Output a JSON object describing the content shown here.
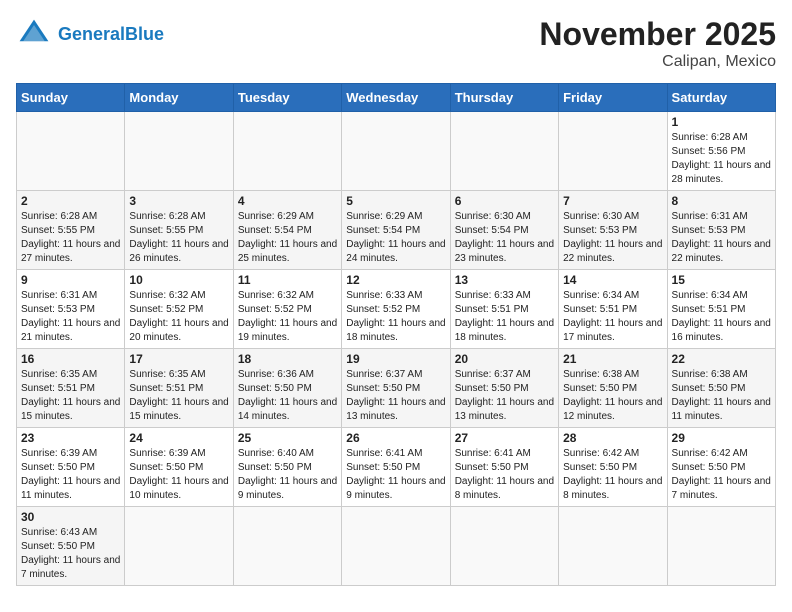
{
  "header": {
    "logo_general": "General",
    "logo_blue": "Blue",
    "title": "November 2025",
    "subtitle": "Calipan, Mexico"
  },
  "weekdays": [
    "Sunday",
    "Monday",
    "Tuesday",
    "Wednesday",
    "Thursday",
    "Friday",
    "Saturday"
  ],
  "weeks": [
    [
      {
        "day": "",
        "info": ""
      },
      {
        "day": "",
        "info": ""
      },
      {
        "day": "",
        "info": ""
      },
      {
        "day": "",
        "info": ""
      },
      {
        "day": "",
        "info": ""
      },
      {
        "day": "",
        "info": ""
      },
      {
        "day": "1",
        "info": "Sunrise: 6:28 AM\nSunset: 5:56 PM\nDaylight: 11 hours and 28 minutes."
      }
    ],
    [
      {
        "day": "2",
        "info": "Sunrise: 6:28 AM\nSunset: 5:55 PM\nDaylight: 11 hours and 27 minutes."
      },
      {
        "day": "3",
        "info": "Sunrise: 6:28 AM\nSunset: 5:55 PM\nDaylight: 11 hours and 26 minutes."
      },
      {
        "day": "4",
        "info": "Sunrise: 6:29 AM\nSunset: 5:54 PM\nDaylight: 11 hours and 25 minutes."
      },
      {
        "day": "5",
        "info": "Sunrise: 6:29 AM\nSunset: 5:54 PM\nDaylight: 11 hours and 24 minutes."
      },
      {
        "day": "6",
        "info": "Sunrise: 6:30 AM\nSunset: 5:54 PM\nDaylight: 11 hours and 23 minutes."
      },
      {
        "day": "7",
        "info": "Sunrise: 6:30 AM\nSunset: 5:53 PM\nDaylight: 11 hours and 22 minutes."
      },
      {
        "day": "8",
        "info": "Sunrise: 6:31 AM\nSunset: 5:53 PM\nDaylight: 11 hours and 22 minutes."
      }
    ],
    [
      {
        "day": "9",
        "info": "Sunrise: 6:31 AM\nSunset: 5:53 PM\nDaylight: 11 hours and 21 minutes."
      },
      {
        "day": "10",
        "info": "Sunrise: 6:32 AM\nSunset: 5:52 PM\nDaylight: 11 hours and 20 minutes."
      },
      {
        "day": "11",
        "info": "Sunrise: 6:32 AM\nSunset: 5:52 PM\nDaylight: 11 hours and 19 minutes."
      },
      {
        "day": "12",
        "info": "Sunrise: 6:33 AM\nSunset: 5:52 PM\nDaylight: 11 hours and 18 minutes."
      },
      {
        "day": "13",
        "info": "Sunrise: 6:33 AM\nSunset: 5:51 PM\nDaylight: 11 hours and 18 minutes."
      },
      {
        "day": "14",
        "info": "Sunrise: 6:34 AM\nSunset: 5:51 PM\nDaylight: 11 hours and 17 minutes."
      },
      {
        "day": "15",
        "info": "Sunrise: 6:34 AM\nSunset: 5:51 PM\nDaylight: 11 hours and 16 minutes."
      }
    ],
    [
      {
        "day": "16",
        "info": "Sunrise: 6:35 AM\nSunset: 5:51 PM\nDaylight: 11 hours and 15 minutes."
      },
      {
        "day": "17",
        "info": "Sunrise: 6:35 AM\nSunset: 5:51 PM\nDaylight: 11 hours and 15 minutes."
      },
      {
        "day": "18",
        "info": "Sunrise: 6:36 AM\nSunset: 5:50 PM\nDaylight: 11 hours and 14 minutes."
      },
      {
        "day": "19",
        "info": "Sunrise: 6:37 AM\nSunset: 5:50 PM\nDaylight: 11 hours and 13 minutes."
      },
      {
        "day": "20",
        "info": "Sunrise: 6:37 AM\nSunset: 5:50 PM\nDaylight: 11 hours and 13 minutes."
      },
      {
        "day": "21",
        "info": "Sunrise: 6:38 AM\nSunset: 5:50 PM\nDaylight: 11 hours and 12 minutes."
      },
      {
        "day": "22",
        "info": "Sunrise: 6:38 AM\nSunset: 5:50 PM\nDaylight: 11 hours and 11 minutes."
      }
    ],
    [
      {
        "day": "23",
        "info": "Sunrise: 6:39 AM\nSunset: 5:50 PM\nDaylight: 11 hours and 11 minutes."
      },
      {
        "day": "24",
        "info": "Sunrise: 6:39 AM\nSunset: 5:50 PM\nDaylight: 11 hours and 10 minutes."
      },
      {
        "day": "25",
        "info": "Sunrise: 6:40 AM\nSunset: 5:50 PM\nDaylight: 11 hours and 9 minutes."
      },
      {
        "day": "26",
        "info": "Sunrise: 6:41 AM\nSunset: 5:50 PM\nDaylight: 11 hours and 9 minutes."
      },
      {
        "day": "27",
        "info": "Sunrise: 6:41 AM\nSunset: 5:50 PM\nDaylight: 11 hours and 8 minutes."
      },
      {
        "day": "28",
        "info": "Sunrise: 6:42 AM\nSunset: 5:50 PM\nDaylight: 11 hours and 8 minutes."
      },
      {
        "day": "29",
        "info": "Sunrise: 6:42 AM\nSunset: 5:50 PM\nDaylight: 11 hours and 7 minutes."
      }
    ],
    [
      {
        "day": "30",
        "info": "Sunrise: 6:43 AM\nSunset: 5:50 PM\nDaylight: 11 hours and 7 minutes."
      },
      {
        "day": "",
        "info": ""
      },
      {
        "day": "",
        "info": ""
      },
      {
        "day": "",
        "info": ""
      },
      {
        "day": "",
        "info": ""
      },
      {
        "day": "",
        "info": ""
      },
      {
        "day": "",
        "info": ""
      }
    ]
  ]
}
